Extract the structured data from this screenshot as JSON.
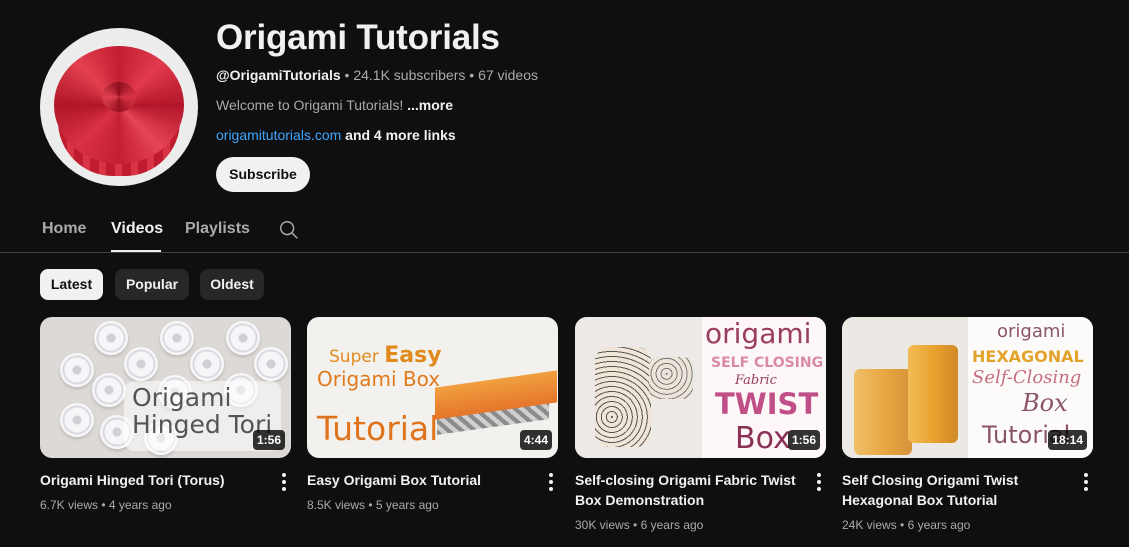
{
  "channel": {
    "name": "Origami Tutorials",
    "handle": "@OrigamiTutorials",
    "subscribers": "24.1K subscribers",
    "videos": "67 videos",
    "separator": "•",
    "description": "Welcome to Origami Tutorials!",
    "more": "...more",
    "link": "origamitutorials.com",
    "more_links": "and 4 more links",
    "subscribe_label": "Subscribe"
  },
  "tabs": [
    {
      "label": "Home"
    },
    {
      "label": "Videos"
    },
    {
      "label": "Playlists"
    }
  ],
  "chips": [
    {
      "label": "Latest"
    },
    {
      "label": "Popular"
    },
    {
      "label": "Oldest"
    }
  ],
  "videos": [
    {
      "title": "Origami Hinged Tori (Torus)",
      "views": "6.7K views",
      "age": "4 years ago",
      "duration": "1:56",
      "thumb_text": [
        "Origami",
        "Hinged Tori"
      ]
    },
    {
      "title": "Easy Origami Box Tutorial",
      "views": "8.5K views",
      "age": "5 years ago",
      "duration": "4:44",
      "thumb_text": [
        "Super",
        "Easy",
        "Origami Box",
        "Tutorial"
      ]
    },
    {
      "title": "Self-closing Origami Fabric Twist Box Demonstration",
      "views": "30K views",
      "age": "6 years ago",
      "duration": "1:56",
      "thumb_text": [
        "origami",
        "SELF CLOSING",
        "Fabric",
        "TWIST",
        "Box"
      ]
    },
    {
      "title": "Self Closing Origami Twist Hexagonal Box Tutorial",
      "views": "24K views",
      "age": "6 years ago",
      "duration": "18:14",
      "thumb_text": [
        "origami",
        "HEXAGONAL",
        "Self-Closing",
        "Box",
        "Tutorial"
      ]
    }
  ],
  "colors": {
    "background": "#0f0f0f",
    "link": "#3ea6ff",
    "chip_bg": "#272727",
    "chip_active_bg": "#f1f1f1"
  }
}
